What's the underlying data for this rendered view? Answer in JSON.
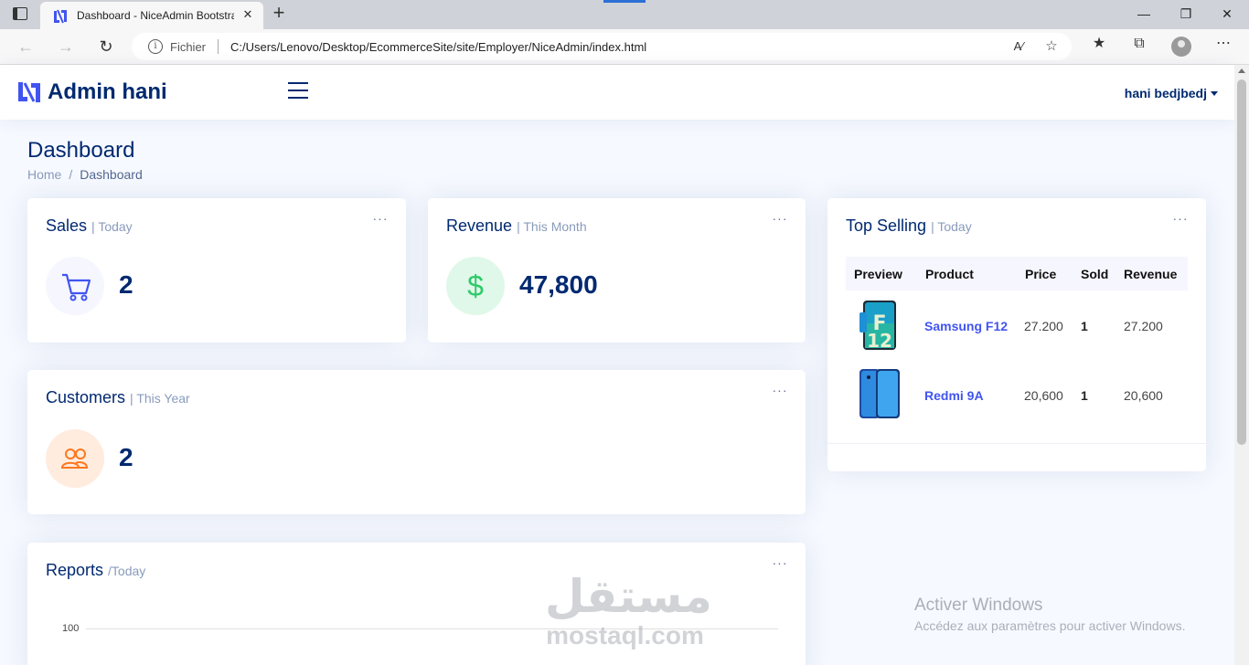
{
  "browser": {
    "tab_title": "Dashboard - NiceAdmin Bootstrap",
    "tab_close": "✕",
    "new_tab": "+",
    "address_scheme": "Fichier",
    "address_url": "C:/Users/Lenovo/Desktop/EcommerceSite/site/Employer/NiceAdmin/index.html"
  },
  "header": {
    "logo_text": "Admin hani",
    "user_name": "hani bedjbedj"
  },
  "page": {
    "title": "Dashboard",
    "breadcrumb": [
      "Home",
      "Dashboard"
    ]
  },
  "cards": {
    "sales": {
      "title": "Sales",
      "subtitle": "| Today",
      "value": "2"
    },
    "revenue": {
      "title": "Revenue",
      "subtitle": "| This Month",
      "value": "47,800",
      "icon_glyph": "$"
    },
    "customers": {
      "title": "Customers",
      "subtitle": "| This Year",
      "value": "2"
    },
    "reports": {
      "title": "Reports",
      "subtitle": "/Today",
      "y_tick": "100"
    },
    "top_selling": {
      "title": "Top Selling",
      "subtitle": "| Today",
      "columns": [
        "Preview",
        "Product",
        "Price",
        "Sold",
        "Revenue"
      ],
      "rows": [
        {
          "product": "Samsung F12",
          "price": "27.200",
          "sold": "1",
          "revenue": "27.200"
        },
        {
          "product": "Redmi 9A",
          "price": "20,600",
          "sold": "1",
          "revenue": "20,600"
        }
      ]
    },
    "dots": "···"
  },
  "watermark": {
    "activate_title": "Activer Windows",
    "activate_sub": "Accédez aux paramètres pour activer Windows.",
    "mostaql_ar": "مستقل",
    "mostaql_en": "mostaql.com"
  },
  "colors": {
    "primary": "#012970",
    "accent": "#4154f1",
    "revenue_green": "#2eca6a",
    "customers_orange": "#ff771d",
    "background": "#f6f9ff"
  }
}
